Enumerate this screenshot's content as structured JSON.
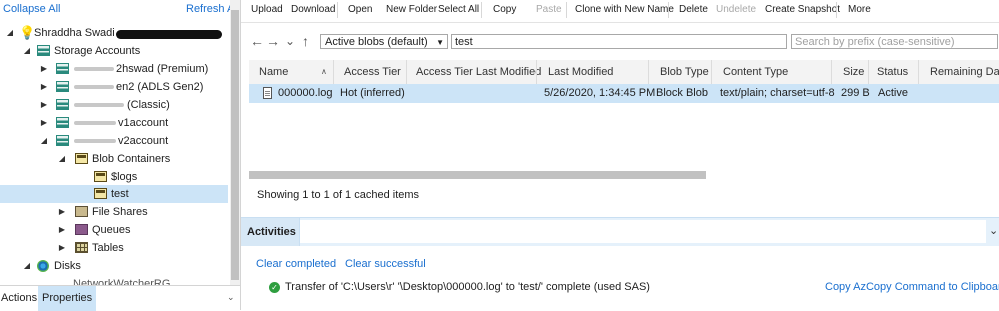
{
  "explorer": {
    "collapse_all": "Collapse All",
    "refresh_all": "Refresh All",
    "tree": [
      {
        "label": "Shraddha Swadi",
        "redacted": true
      },
      {
        "label": "Storage Accounts"
      },
      {
        "label": "2hswad (Premium)",
        "redacted": true
      },
      {
        "label": "en2 (ADLS Gen2)",
        "redacted": true
      },
      {
        "label": "(Classic)",
        "redacted": true
      },
      {
        "label": "v1account",
        "redacted": true
      },
      {
        "label": "v2account",
        "redacted": true
      },
      {
        "label": "Blob Containers"
      },
      {
        "label": "$logs"
      },
      {
        "label": "test"
      },
      {
        "label": "File Shares"
      },
      {
        "label": "Queues"
      },
      {
        "label": "Tables"
      },
      {
        "label": "Disks"
      },
      {
        "label": "NetworkWatcherRG"
      }
    ],
    "bottom_tabs": [
      "Actions",
      "Properties"
    ]
  },
  "toolbar": {
    "items": [
      "Upload",
      "Download",
      "Open",
      "New Folder",
      "Select All",
      "Copy",
      "Paste",
      "Clone with New Name",
      "Delete",
      "Undelete",
      "Create Snapshot",
      "More"
    ],
    "disabled": [
      "Paste",
      "Undelete"
    ]
  },
  "nav": {
    "view_select": "Active blobs (default)",
    "path": "test",
    "prefix_placeholder": "Search by prefix (case-sensitive)"
  },
  "grid": {
    "columns": [
      "Name",
      "Access Tier",
      "Access Tier Last Modified",
      "Last Modified",
      "Blob Type",
      "Content Type",
      "Size",
      "Status",
      "Remaining Days"
    ],
    "rows": [
      {
        "name": "000000.log",
        "access_tier": "Hot (inferred)",
        "access_tier_last_modified": "",
        "last_modified": "5/26/2020, 1:34:45 PM",
        "blob_type": "Block Blob",
        "content_type": "text/plain; charset=utf-8",
        "size": "299 B",
        "status": "Active",
        "remaining_days": ""
      }
    ],
    "status_text": "Showing 1 to 1 of 1 cached items"
  },
  "activities": {
    "title": "Activities",
    "clear_completed": "Clear completed",
    "clear_successful": "Clear successful",
    "entry": "Transfer of 'C:\\Users\\r' '\\Desktop\\000000.log' to 'test/' complete (used SAS)",
    "entry_action": "Copy AzCopy Command to Clipboard"
  },
  "colors": {
    "link": "#1a6fcf",
    "selection": "#cce4f7",
    "success": "#2e9e3f"
  }
}
